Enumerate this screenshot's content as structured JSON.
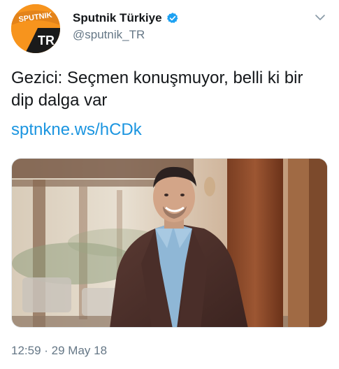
{
  "account": {
    "avatar_text_top": "SPUTNIK",
    "avatar_text_bottom": "TR",
    "display_name": "Sputnik Türkiye",
    "handle": "@sputnik_TR",
    "verified": true
  },
  "tweet": {
    "text": "Gezici: Seçmen konuşmuyor, belli ki bir dip dalga var",
    "link": "sptnkne.ws/hCDk",
    "timestamp": "12:59 · 29 May 18"
  },
  "icons": {
    "verified": "verified-badge-icon",
    "menu": "chevron-down-icon"
  },
  "colors": {
    "brand_orange": "#f7941d",
    "link_blue": "#1b95e0",
    "secondary_text": "#657786",
    "verified_blue": "#1da1f2"
  }
}
